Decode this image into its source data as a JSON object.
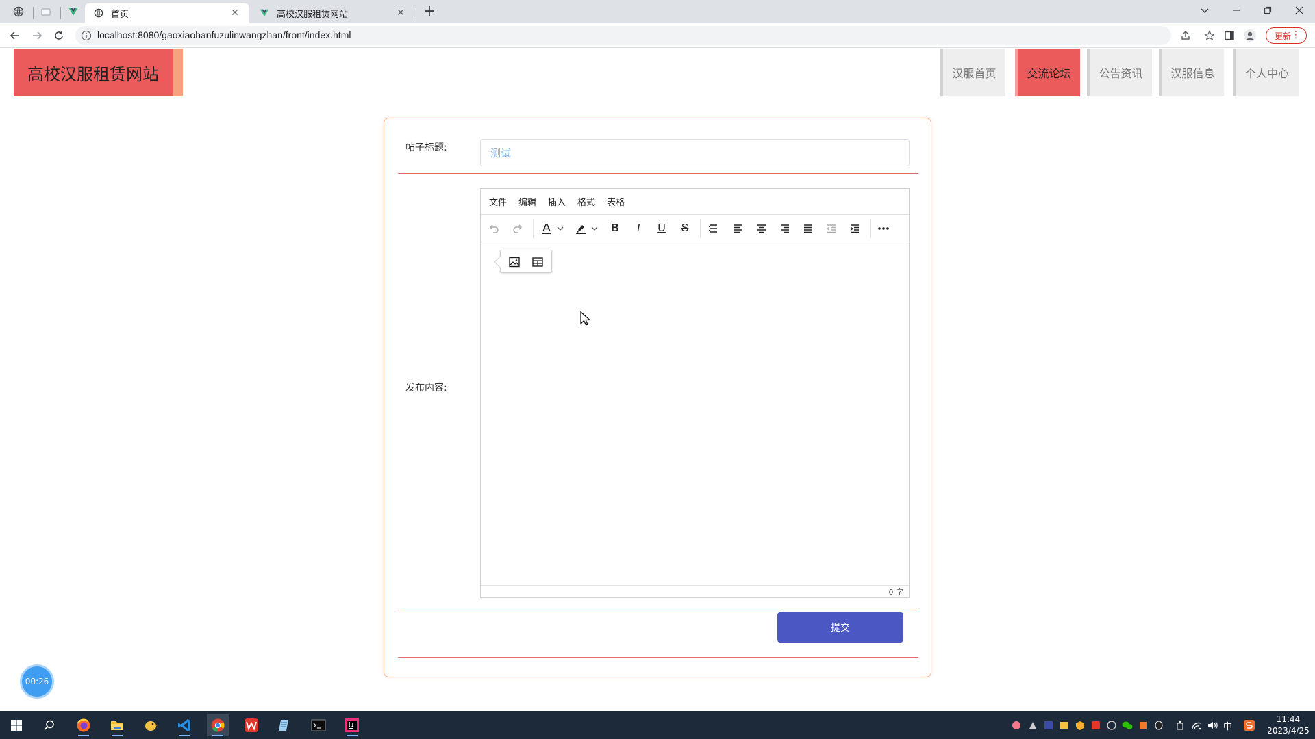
{
  "browser": {
    "tabs": [
      {
        "title": "首页",
        "active": true
      },
      {
        "title": "高校汉服租赁网站",
        "active": false
      }
    ],
    "url": "localhost:8080/gaoxiaohanfuzulinwangzhan/front/index.html",
    "update_label": "更新"
  },
  "site": {
    "logo_text": "高校汉服租赁网站",
    "nav": [
      {
        "label": "汉服首页",
        "active": false
      },
      {
        "label": "交流论坛",
        "active": true
      },
      {
        "label": "公告资讯",
        "active": false
      },
      {
        "label": "汉服信息",
        "active": false
      },
      {
        "label": "个人中心",
        "active": false
      }
    ]
  },
  "form": {
    "title_label": "帖子标题:",
    "title_value": "测试",
    "content_label": "发布内容:",
    "submit_label": "提交"
  },
  "editor": {
    "menus": [
      "文件",
      "编辑",
      "插入",
      "格式",
      "表格"
    ],
    "word_count": "0 字"
  },
  "timer": "00:26",
  "taskbar": {
    "ime": "中",
    "time": "11:44",
    "date": "2023/4/25"
  },
  "colors": {
    "accent_red": "#ec5b5b",
    "logo_side": "#f7a27e",
    "submit_blue": "#4b57c2",
    "card_border": "#f5b08b"
  }
}
